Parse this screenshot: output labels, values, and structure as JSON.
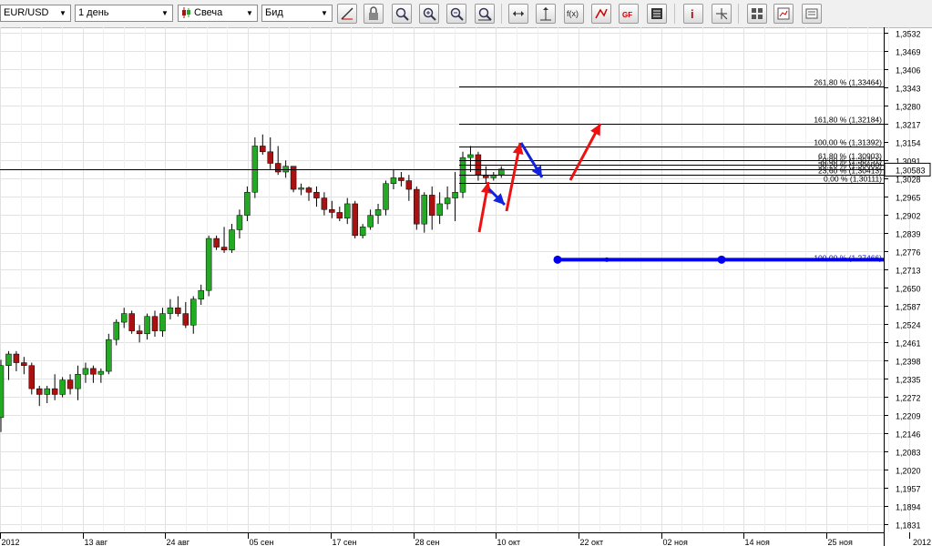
{
  "toolbar": {
    "symbol": "EUR/USD",
    "timeframe": "1 день",
    "chart_style": "Свеча",
    "price_side": "Бид",
    "icons": [
      "draw-line-icon",
      "lock-icon",
      "zoom-fit-icon",
      "zoom-in-icon",
      "zoom-out-icon",
      "zoom-reset-icon",
      "scroll-icon",
      "crosshair-icon",
      "indicators-icon",
      "drawing-tools-icon",
      "fibonacci-icon",
      "data-window-icon",
      "alert-icon",
      "cursor-icon",
      "layout-icon",
      "save-chart-icon",
      "chart-template-icon"
    ]
  },
  "chart_data": {
    "type": "candlestick",
    "symbol": "EUR/USD",
    "colors": {
      "up": "#22aa22",
      "down": "#aa1111",
      "grid": "#e2e2e2",
      "fib": "#000000",
      "arrow_up": "#ee1111",
      "arrow_down": "#1122dd",
      "projection": "#0000ee"
    },
    "y_ticks": [
      "1,3532",
      "1,3469",
      "1,3406",
      "1,3343",
      "1,3280",
      "1,3217",
      "1,3154",
      "1,3091",
      "1,3028",
      "1,2965",
      "1,2902",
      "1,2839",
      "1,2776",
      "1,2713",
      "1,2650",
      "1,2587",
      "1,2524",
      "1,2461",
      "1,2398",
      "1,2335",
      "1,2272",
      "1,2209",
      "1,2146",
      "1,2083",
      "1,2020",
      "1,1957",
      "1,1894",
      "1,1831"
    ],
    "y_range": [
      1.1831,
      1.3532
    ],
    "x_ticks": [
      "2012",
      "13 авг",
      "24 авг",
      "05 сен",
      "17 сен",
      "28 сен",
      "10 окт",
      "22 окт",
      "02 ноя",
      "14 ноя",
      "25 ноя",
      "2012"
    ],
    "last_price": "1,30583",
    "last_price_value": 1.30583,
    "candles": [
      [
        1.22,
        1.24,
        1.215,
        1.238
      ],
      [
        1.238,
        1.243,
        1.233,
        1.242
      ],
      [
        1.242,
        1.243,
        1.236,
        1.239
      ],
      [
        1.239,
        1.241,
        1.235,
        1.238
      ],
      [
        1.238,
        1.239,
        1.228,
        1.23
      ],
      [
        1.23,
        1.231,
        1.224,
        1.228
      ],
      [
        1.228,
        1.231,
        1.225,
        1.23
      ],
      [
        1.23,
        1.235,
        1.226,
        1.228
      ],
      [
        1.228,
        1.234,
        1.227,
        1.233
      ],
      [
        1.233,
        1.235,
        1.228,
        1.23
      ],
      [
        1.23,
        1.238,
        1.226,
        1.235
      ],
      [
        1.235,
        1.239,
        1.232,
        1.237
      ],
      [
        1.237,
        1.238,
        1.232,
        1.235
      ],
      [
        1.235,
        1.237,
        1.232,
        1.236
      ],
      [
        1.236,
        1.249,
        1.235,
        1.247
      ],
      [
        1.247,
        1.254,
        1.245,
        1.253
      ],
      [
        1.253,
        1.258,
        1.251,
        1.256
      ],
      [
        1.256,
        1.257,
        1.249,
        1.25
      ],
      [
        1.25,
        1.252,
        1.246,
        1.249
      ],
      [
        1.249,
        1.256,
        1.247,
        1.255
      ],
      [
        1.255,
        1.257,
        1.248,
        1.25
      ],
      [
        1.25,
        1.258,
        1.248,
        1.256
      ],
      [
        1.256,
        1.261,
        1.254,
        1.258
      ],
      [
        1.258,
        1.262,
        1.255,
        1.256
      ],
      [
        1.256,
        1.26,
        1.251,
        1.252
      ],
      [
        1.252,
        1.262,
        1.249,
        1.261
      ],
      [
        1.261,
        1.266,
        1.259,
        1.264
      ],
      [
        1.264,
        1.283,
        1.262,
        1.282
      ],
      [
        1.282,
        1.283,
        1.278,
        1.279
      ],
      [
        1.279,
        1.286,
        1.277,
        1.278
      ],
      [
        1.278,
        1.287,
        1.277,
        1.285
      ],
      [
        1.285,
        1.292,
        1.282,
        1.29
      ],
      [
        1.29,
        1.3,
        1.288,
        1.298
      ],
      [
        1.298,
        1.317,
        1.296,
        1.314
      ],
      [
        1.314,
        1.318,
        1.311,
        1.312
      ],
      [
        1.312,
        1.317,
        1.306,
        1.308
      ],
      [
        1.308,
        1.314,
        1.304,
        1.305
      ],
      [
        1.305,
        1.309,
        1.303,
        1.307
      ],
      [
        1.307,
        1.307,
        1.298,
        1.299
      ],
      [
        1.299,
        1.301,
        1.297,
        1.2995
      ],
      [
        1.2995,
        1.3,
        1.295,
        1.298
      ],
      [
        1.298,
        1.3,
        1.293,
        1.296
      ],
      [
        1.296,
        1.298,
        1.29,
        1.292
      ],
      [
        1.292,
        1.295,
        1.289,
        1.291
      ],
      [
        1.291,
        1.293,
        1.288,
        1.289
      ],
      [
        1.289,
        1.296,
        1.287,
        1.294
      ],
      [
        1.294,
        1.295,
        1.282,
        1.283
      ],
      [
        1.283,
        1.287,
        1.282,
        1.286
      ],
      [
        1.286,
        1.292,
        1.285,
        1.29
      ],
      [
        1.29,
        1.294,
        1.287,
        1.292
      ],
      [
        1.292,
        1.302,
        1.29,
        1.301
      ],
      [
        1.301,
        1.306,
        1.299,
        1.303
      ],
      [
        1.303,
        1.305,
        1.3,
        1.302
      ],
      [
        1.302,
        1.304,
        1.295,
        1.299
      ],
      [
        1.299,
        1.3,
        1.285,
        1.287
      ],
      [
        1.287,
        1.298,
        1.284,
        1.297
      ],
      [
        1.297,
        1.3,
        1.285,
        1.29
      ],
      [
        1.29,
        1.298,
        1.287,
        1.294
      ],
      [
        1.294,
        1.3,
        1.292,
        1.296
      ],
      [
        1.296,
        1.305,
        1.288,
        1.298
      ],
      [
        1.298,
        1.312,
        1.296,
        1.31
      ],
      [
        1.31,
        1.314,
        1.305,
        1.311
      ],
      [
        1.311,
        1.312,
        1.302,
        1.304
      ],
      [
        1.304,
        1.307,
        1.301,
        1.303
      ],
      [
        1.303,
        1.305,
        1.302,
        1.304
      ],
      [
        1.304,
        1.307,
        1.303,
        1.306
      ]
    ],
    "fibonacci": [
      {
        "label": "261,80 % (1,33464)",
        "value": 1.33464
      },
      {
        "label": "161,80 % (1,32184)",
        "value": 1.32184
      },
      {
        "label": "100,00 % (1,31392)",
        "value": 1.31392
      },
      {
        "label": "61,80 % (1,30903)",
        "value": 1.30903
      },
      {
        "label": "50,00 % (1,30751)",
        "value": 1.30751
      },
      {
        "label": "38,20 % (1,30600)",
        "value": 1.306
      },
      {
        "label": "23,60 % (1,30413)",
        "value": 1.30413
      },
      {
        "label": "0,00 % (1,30111)",
        "value": 1.30111
      }
    ],
    "projection_line": {
      "label": "100,00 % (1,27466)",
      "value": 1.27466
    }
  }
}
